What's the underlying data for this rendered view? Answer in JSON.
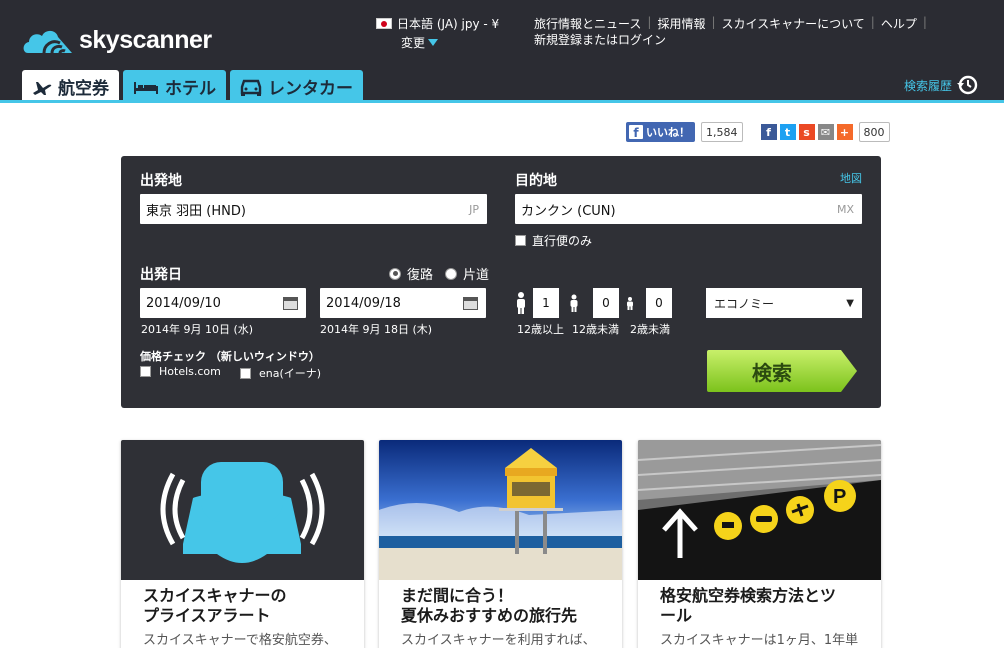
{
  "header": {
    "brand": "skyscanner",
    "locale": "日本語 (JA) jpy - ¥",
    "locale_change": "変更",
    "links": [
      "旅行情報とニュース",
      "採用情報",
      "スカイスキャナーについて",
      "ヘルプ"
    ],
    "login": "新規登録またはログイン",
    "tabs": [
      {
        "label": "航空券",
        "icon": "plane-icon",
        "active": true
      },
      {
        "label": "ホテル",
        "icon": "bed-icon",
        "active": false
      },
      {
        "label": "レンタカー",
        "icon": "car-icon",
        "active": false
      }
    ],
    "history": "検索履歴"
  },
  "social": {
    "like_label": "いいね！",
    "like_count": "1,584",
    "share_count": "800",
    "colors": {
      "facebook": "#3b5998",
      "twitter": "#1da1f2",
      "stumble": "#eb4924",
      "mail": "#888888",
      "plus": "#f56a2a"
    }
  },
  "search": {
    "from_label": "出発地",
    "from_value": "東京 羽田 (HND)",
    "from_country": "JP",
    "to_label": "目的地",
    "to_value": "カンクン (CUN)",
    "to_country": "MX",
    "map_link": "地図",
    "direct_only": "直行便のみ",
    "date_label": "出発日",
    "roundtrip": "復路",
    "oneway": "片道",
    "depart_date": "2014/09/10",
    "depart_note": "2014年 9月 10日 (水)",
    "return_date": "2014/09/18",
    "return_note": "2014年 9月 18日 (木)",
    "adults": "1",
    "adults_label": "12歳以上",
    "children": "0",
    "children_label": "12歳未満",
    "infants": "0",
    "infants_label": "2歳未満",
    "cabin": "エコノミー",
    "price_check": "価格チェック （新しいウィンドウ）",
    "price_opt1": "Hotels.com",
    "price_opt2": "ena(イーナ)",
    "search_button": "検索"
  },
  "cards": [
    {
      "title_l1": "スカイスキャナーの",
      "title_l2": "プライスアラート",
      "desc": "スカイスキャナーで格安航空券、"
    },
    {
      "title_l1": "まだ間に合う！",
      "title_l2": "夏休みおすすめの旅行先",
      "desc": "スカイスキャナーを利用すれば、"
    },
    {
      "title_l1": "格安航空券検索方法とツ",
      "title_l2": "ール",
      "desc": "スカイスキャナーは1ヶ月、1年単"
    }
  ],
  "colors": {
    "accent": "#45c6e8",
    "header_bg": "#2b2c33",
    "panel_bg": "#2f3036",
    "search_green": "#8ed12c"
  }
}
